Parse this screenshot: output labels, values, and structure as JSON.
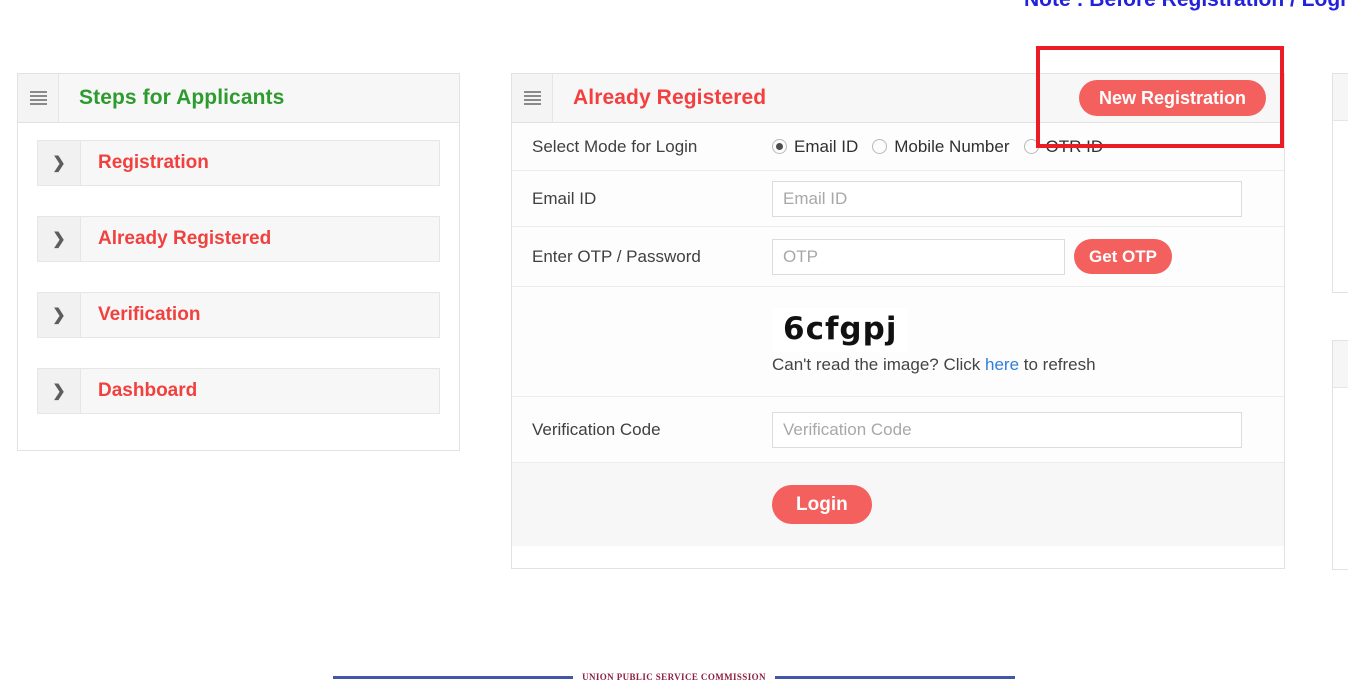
{
  "top_note": "Note : Before Registration / Logi",
  "steps_panel": {
    "menu_icon": "hamburger-icon",
    "title": "Steps for Applicants",
    "title_color": "#2e9b2e",
    "items": [
      {
        "label": "Registration",
        "arrow": "chevron-right-icon"
      },
      {
        "label": "Already Registered",
        "arrow": "chevron-right-icon"
      },
      {
        "label": "Verification",
        "arrow": "chevron-right-icon"
      },
      {
        "label": "Dashboard",
        "arrow": "chevron-right-icon"
      }
    ]
  },
  "login_panel": {
    "menu_icon": "hamburger-icon",
    "title": "Already Registered",
    "title_color": "#f43f3f",
    "new_registration_label": "New Registration",
    "mode_row": {
      "label": "Select Mode for Login",
      "options": [
        {
          "label": "Email ID",
          "selected": true
        },
        {
          "label": "Mobile Number",
          "selected": false
        },
        {
          "label": "OTR ID",
          "selected": false
        }
      ]
    },
    "email_row": {
      "label": "Email ID",
      "value": "",
      "placeholder": "Email ID"
    },
    "otp_row": {
      "label": "Enter OTP / Password",
      "value": "",
      "placeholder": "OTP",
      "button_label": "Get OTP"
    },
    "captcha_row": {
      "code": "6cfgpj",
      "hint_before": "Can't read the image? Click ",
      "hint_link": "here",
      "hint_after": " to refresh"
    },
    "verification_row": {
      "label": "Verification Code",
      "value": "",
      "placeholder": "Verification Code"
    },
    "login_label": "Login"
  },
  "footer": {
    "text": "UNION PUBLIC SERVICE COMMISSION"
  },
  "colors": {
    "accent_red": "#f4605e",
    "title_red": "#f43f3f",
    "title_green": "#2e9b2e",
    "annotation_red": "#ec1c24",
    "link_blue": "#2f7fd8",
    "note_blue": "#2222dd"
  }
}
